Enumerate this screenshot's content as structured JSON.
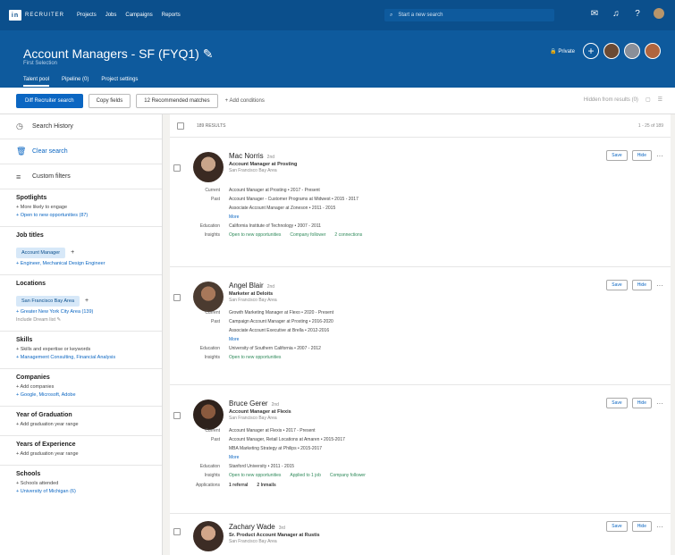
{
  "brand": {
    "logo": "in",
    "label": "RECRUITER"
  },
  "nav": [
    "Projects",
    "Jobs",
    "Campaigns",
    "Reports"
  ],
  "search": {
    "placeholder": "Start a new search"
  },
  "project": {
    "title": "Account Managers - SF (FYQ1)",
    "subtitle": "First Selection",
    "tabs": [
      "Talent pool",
      "Pipeline (0)",
      "Project settings"
    ],
    "visibility": "Private"
  },
  "toolbar": {
    "primary": "Diff Recruiter search",
    "btn2": "Copy fields",
    "btn3": "12 Recommended matches",
    "add": "Add conditions",
    "right_text": "Hidden from results (0)"
  },
  "sidebar": {
    "links": [
      {
        "label": "Search History",
        "icon": "clock-icon"
      },
      {
        "label": "Clear search",
        "icon": "trash-icon"
      },
      {
        "label": "Custom filters",
        "icon": "filter-icon"
      }
    ],
    "spotlights": {
      "title": "Spotlights",
      "rows": [
        "More likely to engage",
        "Open to new opportunities (87)"
      ]
    },
    "job_titles": {
      "title": "Job titles",
      "chip": "Account Manager",
      "suggest": "Engineer, Mechanical Design Engineer"
    },
    "locations": {
      "title": "Locations",
      "chip": "San Francisco Bay Area",
      "suggest": "Greater New York City Area (139)",
      "extra": "Include Dream list"
    },
    "skills": {
      "title": "Skills",
      "rows": [
        "Skills and expertise or keywords",
        "Management Consulting, Financial Analysis"
      ]
    },
    "companies": {
      "title": "Companies",
      "rows": [
        "Add companies",
        "Google, Microsoft, Adobe"
      ]
    },
    "grad": {
      "title": "Year of Graduation",
      "row": "Add graduation year range"
    },
    "exp": {
      "title": "Years of Experience",
      "row": "Add graduation year range"
    },
    "schools": {
      "title": "Schools",
      "rows": [
        "Schools attended",
        "University of Michigan (6)"
      ]
    }
  },
  "results": {
    "count": "189 RESULTS",
    "pager": "1 - 25 of 189"
  },
  "candidates": [
    {
      "name": "Mac Norris",
      "degree": "2nd",
      "headline": "Account Manager at Prosting",
      "location": "San Francisco Bay Area",
      "current": "Account Manager at Prosting • 2017 - Present",
      "past1": "Account Manager - Customer Programs at Midwest • 2015 - 2017",
      "past2": "Associate Account Manager at Zoneson • 2011 - 2015",
      "more": "More",
      "education": "California Institute of Technology • 2007 - 2011",
      "insights": [
        "Open to new opportunities",
        "Company follower",
        "2 connections"
      ]
    },
    {
      "name": "Angel Blair",
      "degree": "2nd",
      "headline": "Marketer at Deloits",
      "location": "San Francisco Bay Area",
      "current": "Growth Marketing Manager at Flexo • 2020 - Present",
      "past1": "Campaign Account Manager at Prosting • 2016-2020",
      "past2": "Associate Account Executive at Brella • 2012-2016",
      "more": "More",
      "education": "University of Southern California • 2007 - 2012",
      "insights": [
        "Open to new opportunities"
      ]
    },
    {
      "name": "Bruce Gerer",
      "degree": "2nd",
      "headline": "Account Manager at Flexis",
      "location": "San Francisco Bay Area",
      "current": "Account Manager at Flexis • 2017 - Present",
      "past1": "Account Manager, Retail Locations at Amaren • 2015-2017",
      "past2": "MBA Marketing Strategy at Philips • 2015-2017",
      "more": "More",
      "education": "Stanford University • 2011 - 2015",
      "insights": [
        "Open to new opportunities",
        "Applied to 1 job",
        "Company follower"
      ],
      "applications": [
        "1 referral",
        "2 Inmails"
      ]
    },
    {
      "name": "Zachary Wade",
      "degree": "3rd",
      "headline": "Sr. Product Account Manager at Rustis",
      "location": "San Francisco Bay Area"
    }
  ],
  "labels": {
    "current": "Current",
    "past": "Past",
    "education": "Education",
    "insights": "Insights",
    "applications": "Applications",
    "save": "Save",
    "hide": "Hide"
  },
  "colors": {
    "topbar": "#0b4f8c",
    "header": "#0e5a9d",
    "primary": "#0b66c2",
    "insight": "#2f8a5a"
  }
}
